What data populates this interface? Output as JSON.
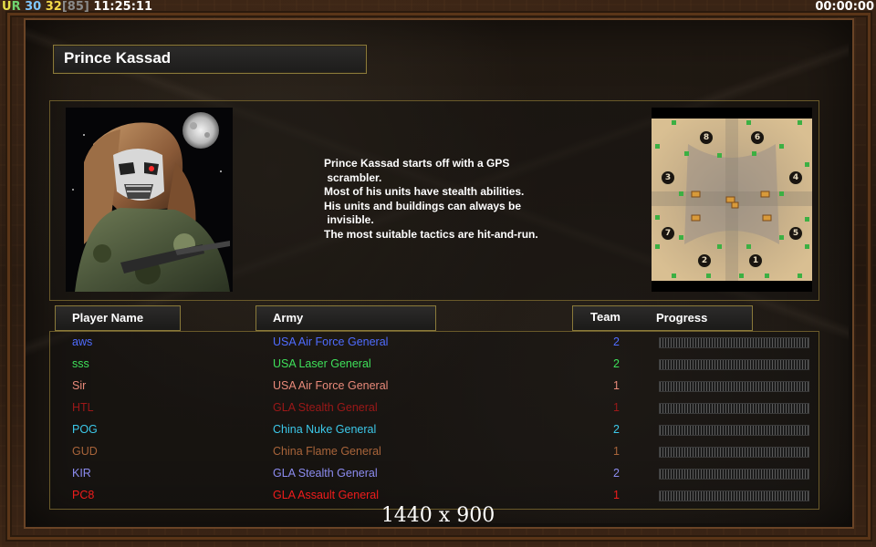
{
  "hud": {
    "ur_u": "U",
    "ur_r": "R",
    "fps": "30",
    "ping": "32",
    "ping_bracket": "[85]",
    "clock": "11:25:11",
    "timer": "00:00:00"
  },
  "general": {
    "name": "Prince Kassad",
    "description": [
      "Prince Kassad starts off with a GPS",
      " scrambler.",
      "Most of his units have stealth abilities.",
      "His units and buildings can always be",
      " invisible.",
      "The most suitable tactics are hit-and-run."
    ]
  },
  "minimap": {
    "start_positions": [
      "8",
      "6",
      "3",
      "4",
      "7",
      "5",
      "2",
      "1"
    ]
  },
  "columns": {
    "player_name": "Player Name",
    "army": "Army",
    "team": "Team",
    "progress": "Progress"
  },
  "players": [
    {
      "name": "aws",
      "army": "USA Air Force General",
      "team": "2",
      "color": "#4f6cff",
      "progress": 0
    },
    {
      "name": "sss",
      "army": "USA Laser General",
      "team": "2",
      "color": "#3ee05a",
      "progress": 0
    },
    {
      "name": "Sir",
      "army": "USA Air Force General",
      "team": "1",
      "color": "#e98a7a",
      "progress": 0
    },
    {
      "name": "HTL",
      "army": "GLA Stealth General",
      "team": "1",
      "color": "#9c1818",
      "progress": 0
    },
    {
      "name": "POG",
      "army": "China Nuke General",
      "team": "2",
      "color": "#3cc9ea",
      "progress": 0
    },
    {
      "name": "GUD",
      "army": "China Flame General",
      "team": "1",
      "color": "#a8643a",
      "progress": 0
    },
    {
      "name": "KIR",
      "army": "GLA Stealth General",
      "team": "2",
      "color": "#8c8cf0",
      "progress": 0
    },
    {
      "name": "PC8",
      "army": "GLA Assault General",
      "team": "1",
      "color": "#f01c1c",
      "progress": 0
    }
  ],
  "resolution": "1440 x 900"
}
